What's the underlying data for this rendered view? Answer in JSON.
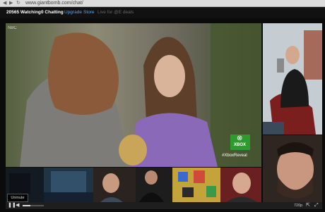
{
  "browser": {
    "url": "www.giantbomb.com/chat/"
  },
  "header": {
    "watching": "20565 Watching",
    "chatting": "0 Chatting",
    "upgrade": "Upgrade",
    "store": "Store",
    "live_note": "Live for @E deals"
  },
  "video": {
    "overlay_brand": "XBOX",
    "overlay_caption": "#XboxReveal",
    "channel_bug": "NBC"
  },
  "player": {
    "tooltip": "Unmute",
    "quality": "720p",
    "volume_level": 0.35
  },
  "colors": {
    "link": "#5fa8e6",
    "xbox_green": "#2e9b2e",
    "bar_bg": "#111111"
  }
}
